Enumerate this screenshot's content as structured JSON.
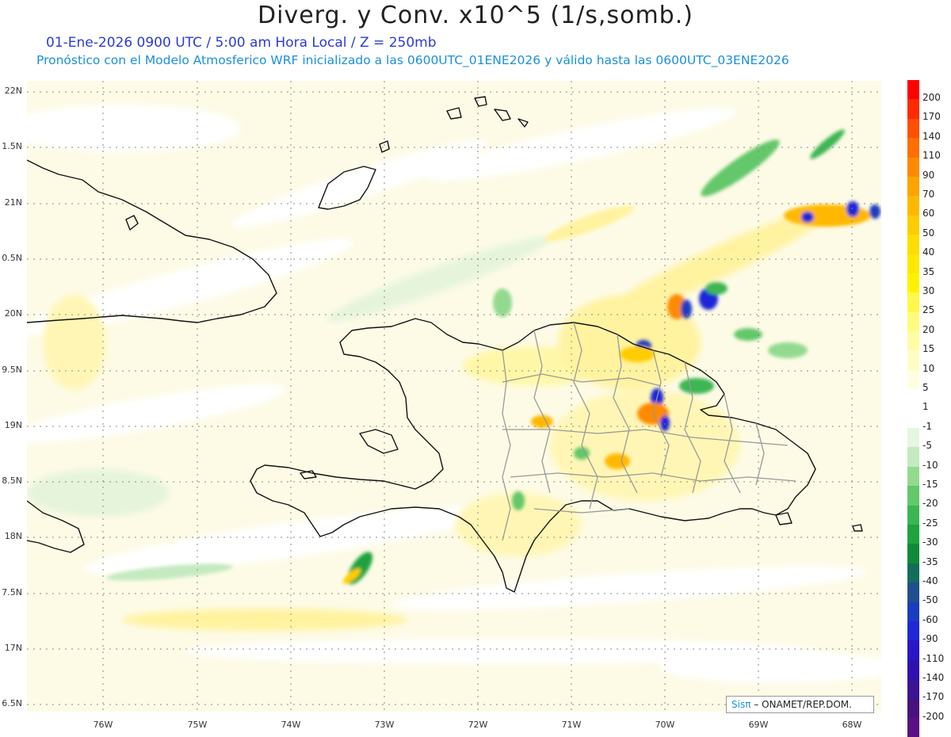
{
  "header": {
    "title": "Diverg. y Conv. x10^5 (1/s,somb.)",
    "line1": "01-Ene-2026  0900 UTC / 5:00 am Hora Local / Z = 250mb",
    "line2": "Pronóstico con el Modelo Atmosferico WRF inicializado a las 0600UTC_01ENE2026 y válido hasta las  0600UTC_03ENE2026"
  },
  "axes": {
    "lat_labels": [
      "22N",
      "1.5N",
      "21N",
      "0.5N",
      "20N",
      "9.5N",
      "19N",
      "8.5N",
      "18N",
      "7.5N",
      "17N",
      "6.5N"
    ],
    "lon_labels": [
      "76W",
      "75W",
      "74W",
      "73W",
      "72W",
      "71W",
      "70W",
      "69W",
      "68W"
    ]
  },
  "colorbar": {
    "labels": [
      "200",
      "170",
      "140",
      "110",
      "90",
      "70",
      "60",
      "50",
      "40",
      "35",
      "30",
      "25",
      "20",
      "15",
      "10",
      "5",
      "1",
      "-1",
      "-5",
      "-10",
      "-15",
      "-20",
      "-25",
      "-30",
      "-35",
      "-40",
      "-50",
      "-60",
      "-90",
      "-110",
      "-140",
      "-170",
      "-200"
    ],
    "colors": [
      "#ff0000",
      "#ff2a00",
      "#ff4f00",
      "#ff6e00",
      "#ff8a00",
      "#ffa300",
      "#ffb800",
      "#ffcc00",
      "#ffdd00",
      "#ffe800",
      "#fff200",
      "#fff84a",
      "#fffb80",
      "#fffca6",
      "#fffdc6",
      "#fffee0",
      "#ffffff",
      "#ffffff",
      "#e6f6e0",
      "#c4eac0",
      "#93da8f",
      "#63c86a",
      "#3cb652",
      "#1fa33f",
      "#0f8a3a",
      "#126e5a",
      "#1f4f8f",
      "#1a3cc0",
      "#1f28d8",
      "#2a16c8",
      "#2f10b0",
      "#3a1494",
      "#48127e",
      "#5a0f82"
    ]
  },
  "credit": {
    "brand": "Sisπ",
    "text": " – ONAMET/REP.DOM."
  }
}
